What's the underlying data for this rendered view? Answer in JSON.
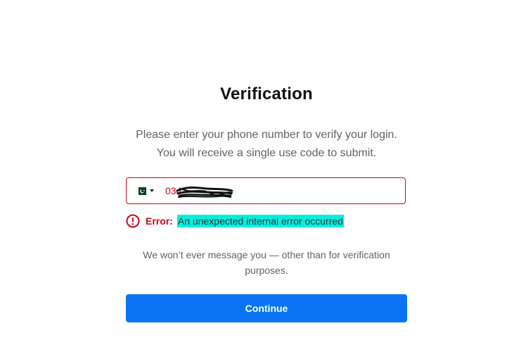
{
  "verification": {
    "title": "Verification",
    "subtitle_line1": "Please enter your phone number to verify your login.",
    "subtitle_line2": "You will receive a single use code to submit."
  },
  "phone": {
    "country_flag": "pakistan-flag-icon",
    "value": "034",
    "redaction": "scribble-redaction"
  },
  "error": {
    "label": "Error:",
    "message": "An unexpected internal error occurred",
    "highlight_color": "#00f0e0",
    "color": "#d0021b"
  },
  "note": {
    "text": "We won’t ever message you — other than for verification purposes."
  },
  "actions": {
    "continue_label": "Continue",
    "button_color": "#0a74f5"
  }
}
